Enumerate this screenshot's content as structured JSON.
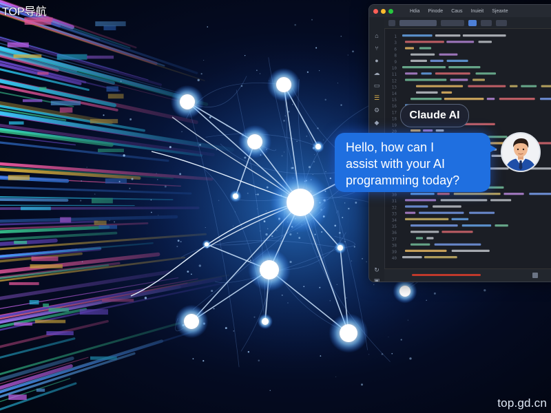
{
  "watermark": {
    "top_left": "TOP导航",
    "bottom_right": "top.gd.cn"
  },
  "editor": {
    "menu": [
      "Hdia",
      "Pinode",
      "Caus",
      "Inuieit",
      "Sjeaxte"
    ],
    "line_numbers": [
      "1",
      "3",
      "6",
      "8",
      "9",
      "10",
      "11",
      "12",
      "13",
      "14",
      "15",
      "16",
      "17",
      "18",
      "19",
      "20",
      "21",
      "22",
      "23",
      "24",
      "25",
      "26",
      "27",
      "28",
      "29",
      "30",
      "31",
      "32",
      "33",
      "34",
      "35",
      "36",
      "37",
      "38",
      "39",
      "40"
    ]
  },
  "chat": {
    "assistant_label": "Claude AI",
    "message_lines": [
      "Hello, how can I",
      "assist with your AI",
      "programming today?"
    ]
  },
  "colors": {
    "bubble": "#1f6fe0",
    "node_glow": "#bfe3ff",
    "background": "#040a1f"
  }
}
